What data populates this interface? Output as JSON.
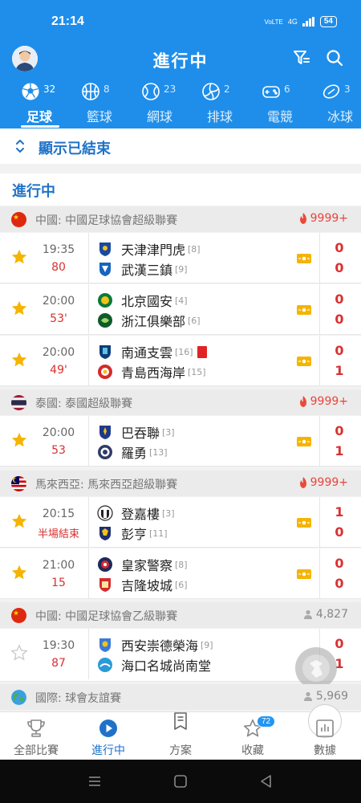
{
  "status_bar": {
    "time": "21:14",
    "network": "VoLTE",
    "signal": "4G",
    "battery": "54"
  },
  "header": {
    "title": "進行中",
    "avatar_icon": "user-avatar",
    "filter_icon": "filter-icon",
    "search_icon": "search-icon"
  },
  "sport_tabs": [
    {
      "label": "足球",
      "count": "32",
      "icon": "soccer-ball-icon",
      "active": true
    },
    {
      "label": "籃球",
      "count": "8",
      "icon": "basketball-icon"
    },
    {
      "label": "網球",
      "count": "23",
      "icon": "tennis-ball-icon"
    },
    {
      "label": "排球",
      "count": "2",
      "icon": "volleyball-icon"
    },
    {
      "label": "電競",
      "count": "6",
      "icon": "gamepad-icon"
    },
    {
      "label": "冰球",
      "count": "3",
      "icon": "hockey-puck-icon"
    }
  ],
  "show_ended": {
    "label": "顯示已結束"
  },
  "section_heading": "進行中",
  "leagues": [
    {
      "country": "中國",
      "name": "中國: 中國足球協會超級聯賽",
      "hot": "9999+"
    },
    {
      "country": "泰國",
      "name": "泰國: 泰國超級聯賽",
      "hot": "9999+"
    },
    {
      "country": "馬來西亞",
      "name": "馬來西亞: 馬來西亞超級聯賽",
      "hot": "9999+"
    },
    {
      "country": "中國",
      "name": "中國: 中國足球協會乙級聯賽",
      "viewers": "4,827"
    },
    {
      "country": "國際",
      "name": "國際: 球會友誼賽",
      "viewers": "5,969"
    }
  ],
  "matches": [
    {
      "time": "19:35",
      "minute": "80",
      "favorite": true,
      "home": "天津津門虎",
      "home_rank": "[8]",
      "away": "武漢三鎮",
      "away_rank": "[9]",
      "home_score": "0",
      "away_score": "0"
    },
    {
      "time": "20:00",
      "minute": "53'",
      "favorite": true,
      "home": "北京國安",
      "home_rank": "[4]",
      "away": "浙江俱樂部",
      "away_rank": "[6]",
      "home_score": "0",
      "away_score": "0"
    },
    {
      "time": "20:00",
      "minute": "49'",
      "favorite": true,
      "home": "南通支雲",
      "home_rank": "[16]",
      "home_red_card": true,
      "away": "青島西海岸",
      "away_rank": "[15]",
      "home_score": "0",
      "away_score": "1"
    },
    {
      "time": "20:00",
      "minute": "53",
      "favorite": true,
      "home": "巴吞聯",
      "home_rank": "[3]",
      "away": "羅勇",
      "away_rank": "[13]",
      "home_score": "0",
      "away_score": "1"
    },
    {
      "time": "20:15",
      "minute": "半場結束",
      "favorite": true,
      "home": "登嘉樓",
      "home_rank": "[3]",
      "away": "彭亨",
      "away_rank": "[11]",
      "home_score": "1",
      "away_score": "0"
    },
    {
      "time": "21:00",
      "minute": "15",
      "favorite": true,
      "home": "皇家警察",
      "home_rank": "[8]",
      "away": "吉隆坡城",
      "away_rank": "[6]",
      "home_score": "0",
      "away_score": "0"
    },
    {
      "time": "19:30",
      "minute": "87",
      "favorite": false,
      "home": "西安崇德榮海",
      "home_rank": "[9]",
      "away": "海口名城尚南堂",
      "away_rank": "",
      "home_score": "0",
      "away_score": "1"
    }
  ],
  "bottom_nav": [
    {
      "label": "全部比賽",
      "icon": "trophy-icon"
    },
    {
      "label": "進行中",
      "icon": "play-circle-icon",
      "active": true
    },
    {
      "label": "方案",
      "icon": "document-icon"
    },
    {
      "label": "收藏",
      "icon": "star-icon",
      "badge": "72"
    },
    {
      "label": "數據",
      "icon": "bar-chart-icon"
    }
  ],
  "colors": {
    "primary": "#1f8eea",
    "accent_text": "#1f72c8",
    "live_red": "#d93131",
    "star": "#f5b400",
    "live_icon": "#f5b400"
  }
}
